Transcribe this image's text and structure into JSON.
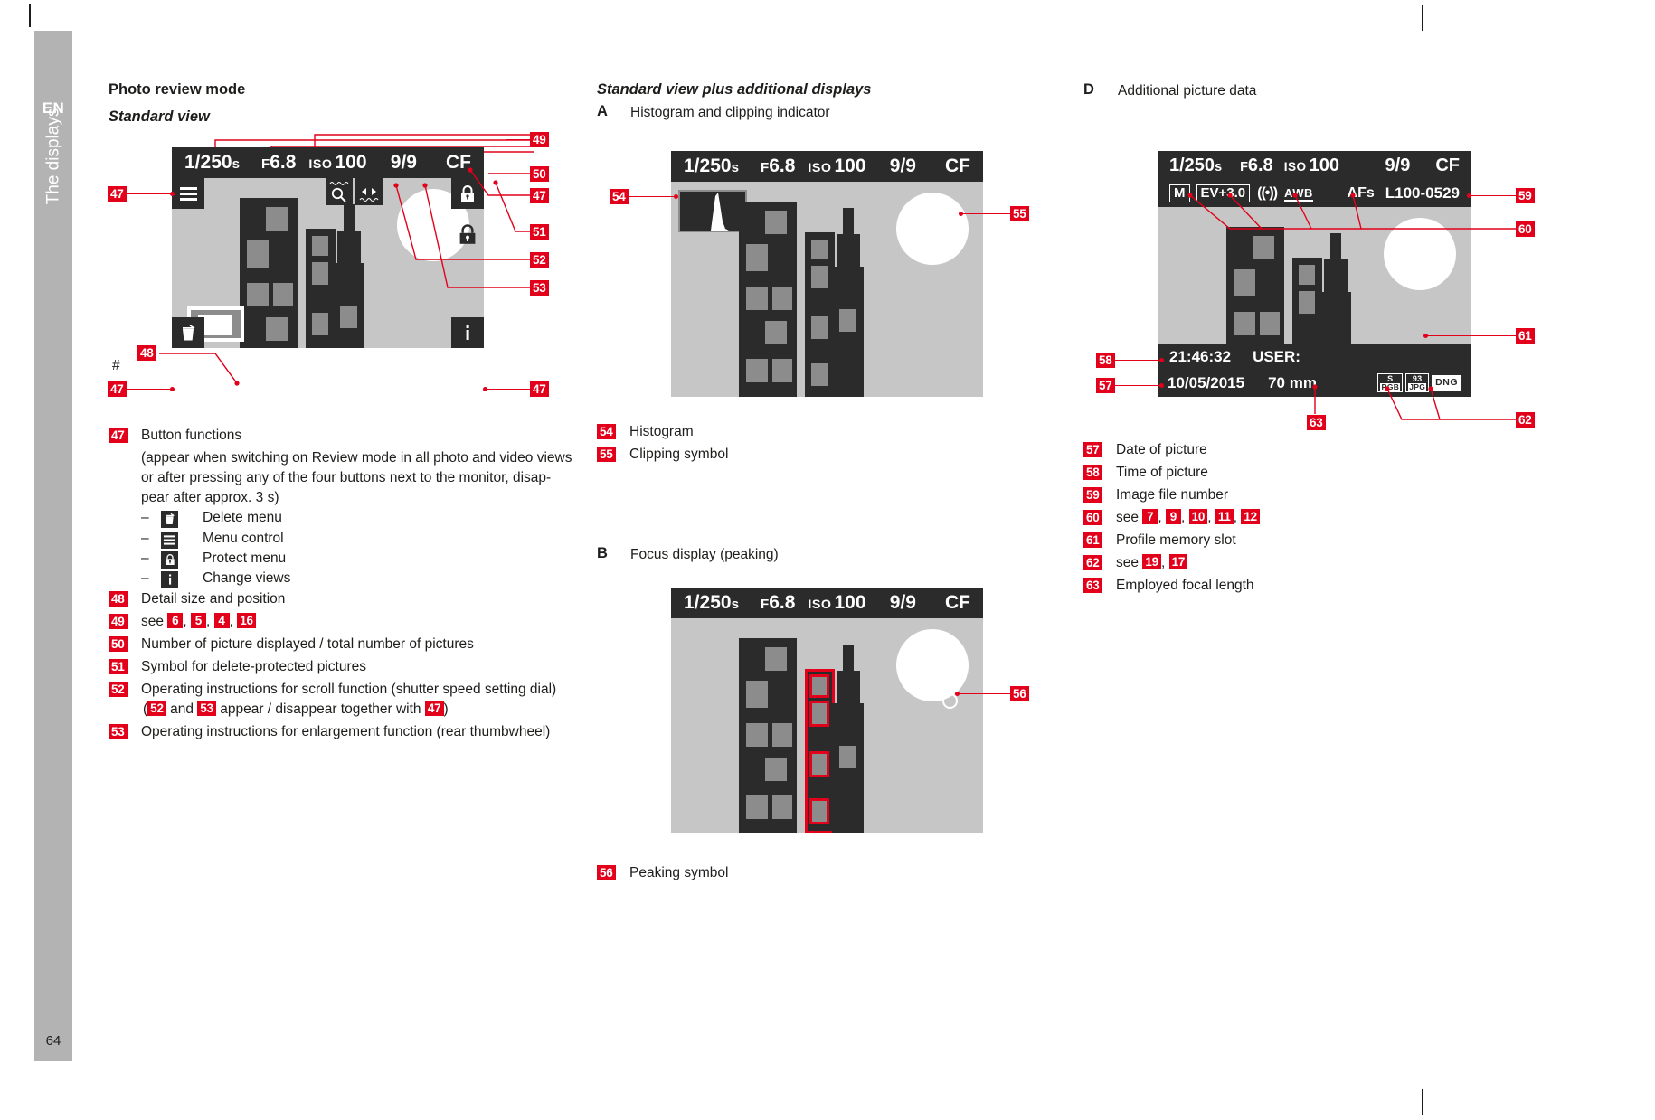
{
  "sidebar": {
    "lang": "EN",
    "section": "The displays",
    "page": "64"
  },
  "col1": {
    "title": "Photo review mode",
    "subtitle": "Standard view",
    "hash": "#",
    "display": {
      "shutter": "1/250",
      "shutter_unit": "s",
      "aperture_prefix": "F",
      "aperture": "6.8",
      "iso_label": "ISO",
      "iso": "100",
      "count": "9/9",
      "card": "CF"
    },
    "callouts": [
      "47",
      "47",
      "47",
      "47",
      "48",
      "49",
      "50",
      "51",
      "52",
      "53"
    ],
    "legend": [
      {
        "no": "47",
        "text": "Button functions"
      },
      {
        "no": "48",
        "text": "Detail size and position"
      },
      {
        "no": "50",
        "text": "Number of picture displayed / total number of pictures"
      },
      {
        "no": "51",
        "text": "Symbol for delete-protected pictures"
      },
      {
        "no": "52",
        "text": "Operating instructions for scroll function (shutter speed setting dial)"
      },
      {
        "no": "53",
        "text": "Operating instructions for enlargement function (rear thumbwheel)"
      }
    ],
    "l47_note_line1": "(appear when switching on Review mode in all photo and video views",
    "l47_note_line2": "or after pressing any of the four buttons next to the monitor, disap-",
    "l47_note_line3": "pear after approx. 3 s)",
    "l47_subitems": [
      {
        "icon": "trash-icon",
        "label": "Delete menu"
      },
      {
        "icon": "menu-icon",
        "label": "Menu control"
      },
      {
        "icon": "lock-icon",
        "label": "Protect menu"
      },
      {
        "icon": "info-icon",
        "label": "Change views"
      }
    ],
    "l49_prefix": "see",
    "l49_refs": [
      "6",
      "5",
      "4",
      "16"
    ],
    "l52_sub_a": "(",
    "l52_sub_r1": "52",
    "l52_sub_b": "and",
    "l52_sub_r2": "53",
    "l52_sub_c": "appear / disappear together with",
    "l52_sub_r3": "47",
    "l52_sub_d": ")"
  },
  "col2": {
    "title": "Standard view plus additional displays",
    "a_letter": "A",
    "a_title": "Histogram and clipping indicator",
    "b_letter": "B",
    "b_title": "Focus display (peaking)",
    "display": {
      "shutter": "1/250",
      "shutter_unit": "s",
      "aperture_prefix": "F",
      "aperture": "6.8",
      "iso_label": "ISO",
      "iso": "100",
      "count": "9/9",
      "card": "CF"
    },
    "clipping_symbol": "[ ]",
    "callouts": [
      "54",
      "55",
      "56"
    ],
    "legend_a": [
      {
        "no": "54",
        "text": "Histogram"
      },
      {
        "no": "55",
        "text": "Clipping symbol"
      }
    ],
    "legend_b": [
      {
        "no": "56",
        "text": "Peaking symbol"
      }
    ]
  },
  "col3": {
    "d_letter": "D",
    "d_title": "Additional picture data",
    "display": {
      "shutter": "1/250",
      "shutter_unit": "s",
      "aperture_prefix": "F",
      "aperture": "6.8",
      "iso_label": "ISO",
      "iso": "100",
      "count": "9/9",
      "card": "CF",
      "mode": "M",
      "ev": "EV+3.0",
      "metering": "((•))",
      "wb": "AWB",
      "af": "AFs",
      "file": "L100-0529",
      "time": "21:46:32",
      "user_label": "USER:",
      "date": "10/05/2015",
      "focal": "70 mm",
      "chip_rgb_top": "S",
      "chip_rgb_bot": "RGB",
      "chip_jpg_top": "93",
      "chip_jpg_bot": "JPG",
      "chip_dng": "DNG"
    },
    "callouts": [
      "59",
      "60",
      "61",
      "58",
      "57",
      "63",
      "62"
    ],
    "legend": [
      {
        "no": "57",
        "text": "Date of picture"
      },
      {
        "no": "58",
        "text": "Time of picture"
      },
      {
        "no": "59",
        "text": "Image file number"
      },
      {
        "no": "61",
        "text": "Profile memory slot"
      },
      {
        "no": "63",
        "text": "Employed focal length"
      }
    ],
    "l60_prefix": "see",
    "l60_refs": [
      "7",
      "9",
      "10",
      "11",
      "12"
    ],
    "l62_prefix": "see",
    "l62_refs": [
      "19",
      "17"
    ]
  }
}
